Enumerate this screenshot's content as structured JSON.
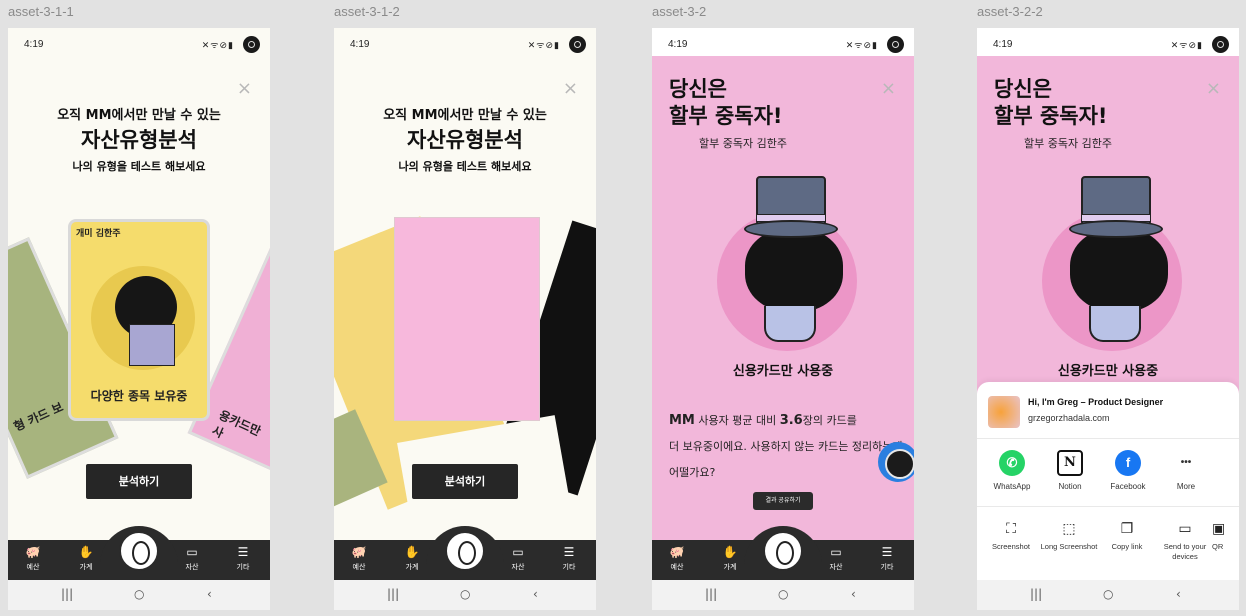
{
  "frames": [
    {
      "label": "asset-3-1-1"
    },
    {
      "label": "asset-3-1-2"
    },
    {
      "label": "asset-3-2"
    },
    {
      "label": "asset-3-2-2"
    }
  ],
  "status": {
    "time": "4:19",
    "icons": "✕ᯤ⊘▮"
  },
  "close_icon": "×",
  "intro": {
    "pre_title": "오직 MM에서만 만날 수 있는",
    "title": "자산유형분석",
    "subtitle": "나의 유형을 테스트 해보세요",
    "cta": "분석하기"
  },
  "cards": {
    "main_name": "개미 김한주",
    "main_caption": "다양한 종목 보유중",
    "left_text": "형 카드 보",
    "right_text": "용카드만 사"
  },
  "result": {
    "title_line1": "당신은",
    "title_line2": "할부 중독자!",
    "user": "할부 중독자 김한주",
    "label": "신용카드만 사용중",
    "desc_prefix": "MM",
    "desc_mid1": " 사용자 평균 대비 ",
    "desc_count": "3.6",
    "desc_mid2": "장의 카드를",
    "desc_line2": "더 보유중이에요. 사용하지 않는 카드는 정리하는게",
    "desc_line3": "어떨가요?",
    "share_button": "결과 공유하기"
  },
  "navbar": {
    "items": [
      {
        "label": "예산",
        "icon": "piggy-bank-icon",
        "glyph": "🐖"
      },
      {
        "label": "가계",
        "icon": "hand-coin-icon",
        "glyph": "✋"
      },
      {
        "label": "자산",
        "icon": "wallet-icon",
        "glyph": "▭"
      },
      {
        "label": "기타",
        "icon": "menu-icon",
        "glyph": "☰"
      }
    ]
  },
  "sysnav": {
    "recents": "|||",
    "home": "○",
    "back": "‹"
  },
  "share_sheet": {
    "title": "Hi, I'm Greg – Product Designer",
    "url": "grzegorzhadala.com",
    "apps": [
      {
        "label": "WhatsApp",
        "glyph": "✆",
        "color": "#25d366"
      },
      {
        "label": "Notion",
        "glyph": "N",
        "color": "#111111"
      },
      {
        "label": "Facebook",
        "glyph": "f",
        "color": "#1877f2"
      },
      {
        "label": "More",
        "glyph": "•••",
        "color": "#ffffff"
      }
    ],
    "tools": [
      {
        "label": "Screenshot",
        "glyph": "⛶"
      },
      {
        "label": "Long Screenshot",
        "glyph": "⬚"
      },
      {
        "label": "Copy link",
        "glyph": "❐"
      },
      {
        "label": "Send to your devices",
        "glyph": "▭"
      },
      {
        "label": "QR",
        "glyph": "▣"
      }
    ]
  },
  "colors": {
    "accent_pink": "#f2b7da",
    "nav_dark": "#2b2b2b",
    "card_yellow": "#f5dc6c"
  }
}
